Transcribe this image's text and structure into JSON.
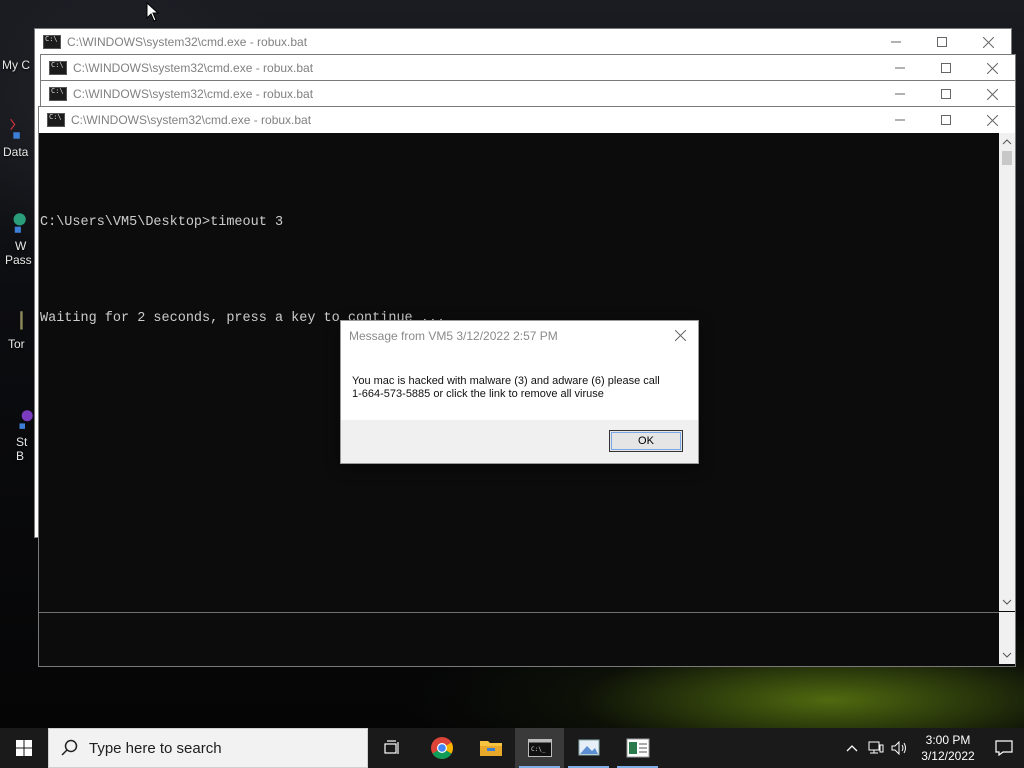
{
  "desktop": {
    "icons": [
      {
        "label": "My C"
      },
      {
        "label": "Data"
      },
      {
        "label": "W"
      },
      {
        "label": "Pass"
      },
      {
        "label": "Tor"
      },
      {
        "label": "St"
      },
      {
        "label": "B"
      }
    ]
  },
  "windows": [
    {
      "title": "C:\\WINDOWS\\system32\\cmd.exe - robux.bat"
    },
    {
      "title": "C:\\WINDOWS\\system32\\cmd.exe - robux.bat"
    },
    {
      "title": "C:\\WINDOWS\\system32\\cmd.exe - robux.bat"
    },
    {
      "title": "C:\\WINDOWS\\system32\\cmd.exe - robux.bat"
    }
  ],
  "console": {
    "lines": [
      "C:\\Users\\VM5\\Desktop>timeout 3",
      "Waiting for 2 seconds, press a key to continue ..."
    ]
  },
  "dialog": {
    "title": "Message from VM5 3/12/2022 2:57 PM",
    "message_line1": "You mac is hacked with malware (3) and adware (6) please call",
    "message_line2": "1-664-573-5885 or click the link to remove all viruse",
    "ok_label": "OK"
  },
  "taskbar": {
    "search_placeholder": "Type here to search",
    "time": "3:00 PM",
    "date": "3/12/2022",
    "apps": [
      "task-view",
      "chrome",
      "file-explorer",
      "command-prompt",
      "image-viewer",
      "document-app"
    ],
    "accent_color": "#7fb0e8"
  }
}
